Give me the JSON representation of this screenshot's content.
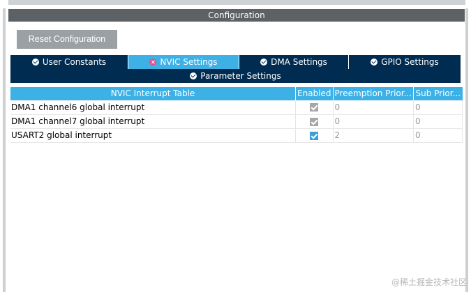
{
  "panel": {
    "title": "Configuration"
  },
  "toolbar": {
    "reset_label": "Reset Configuration"
  },
  "tabs": [
    {
      "label": "User Constants",
      "icon": "check-circle-icon",
      "active": false
    },
    {
      "label": "NVIC Settings",
      "icon": "x-circle-icon",
      "active": true
    },
    {
      "label": "DMA Settings",
      "icon": "check-circle-icon",
      "active": false
    },
    {
      "label": "GPIO Settings",
      "icon": "check-circle-icon",
      "active": false
    },
    {
      "label": "Parameter Settings",
      "icon": "check-circle-icon",
      "active": false
    }
  ],
  "table": {
    "headers": [
      "NVIC Interrupt Table",
      "Enabled",
      "Preemption Prior...",
      "Sub Prior..."
    ],
    "rows": [
      {
        "name": "DMA1 channel6 global interrupt",
        "enabled": true,
        "editable": false,
        "preemption": "0",
        "sub": "0"
      },
      {
        "name": "DMA1 channel7 global interrupt",
        "enabled": true,
        "editable": false,
        "preemption": "0",
        "sub": "0"
      },
      {
        "name": "USART2 global interrupt",
        "enabled": true,
        "editable": true,
        "preemption": "2",
        "sub": "0"
      }
    ]
  },
  "watermark": "@稀土掘金技术社区",
  "colors": {
    "header_bg": "#5b6164",
    "tab_dark": "#002c52",
    "tab_active": "#3db0e6",
    "button_bg": "#9aa0a4",
    "checkbox_blue": "#3b9fdc",
    "checkbox_grey": "#a7a7a7"
  }
}
